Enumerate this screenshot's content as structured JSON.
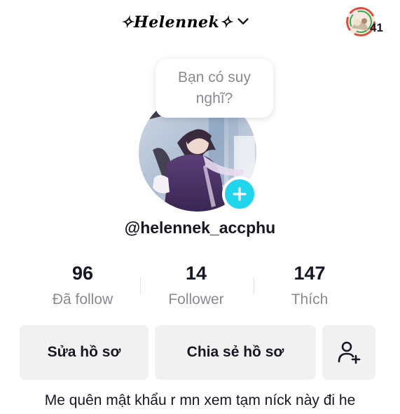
{
  "header": {
    "display_name": "✧Helennek✧",
    "activity_count": "41"
  },
  "prompt_bubble": {
    "text": "Bạn có suy nghĩ?"
  },
  "profile": {
    "handle": "@helennek_accphu",
    "bio": "Me quên mật khẩu r mn xem tạm níck này đi he"
  },
  "stats": [
    {
      "value": "96",
      "label": "Đã follow"
    },
    {
      "value": "14",
      "label": "Follower"
    },
    {
      "value": "147",
      "label": "Thích"
    }
  ],
  "actions": {
    "edit_label": "Sửa hồ sơ",
    "share_label": "Chia sẻ hồ sơ",
    "add_friend_icon": "add-person-icon"
  },
  "colors": {
    "accent_add": "#20d5ec",
    "button_bg": "#f1f1f2",
    "text_primary": "#161823",
    "text_secondary": "#8a8b91"
  }
}
